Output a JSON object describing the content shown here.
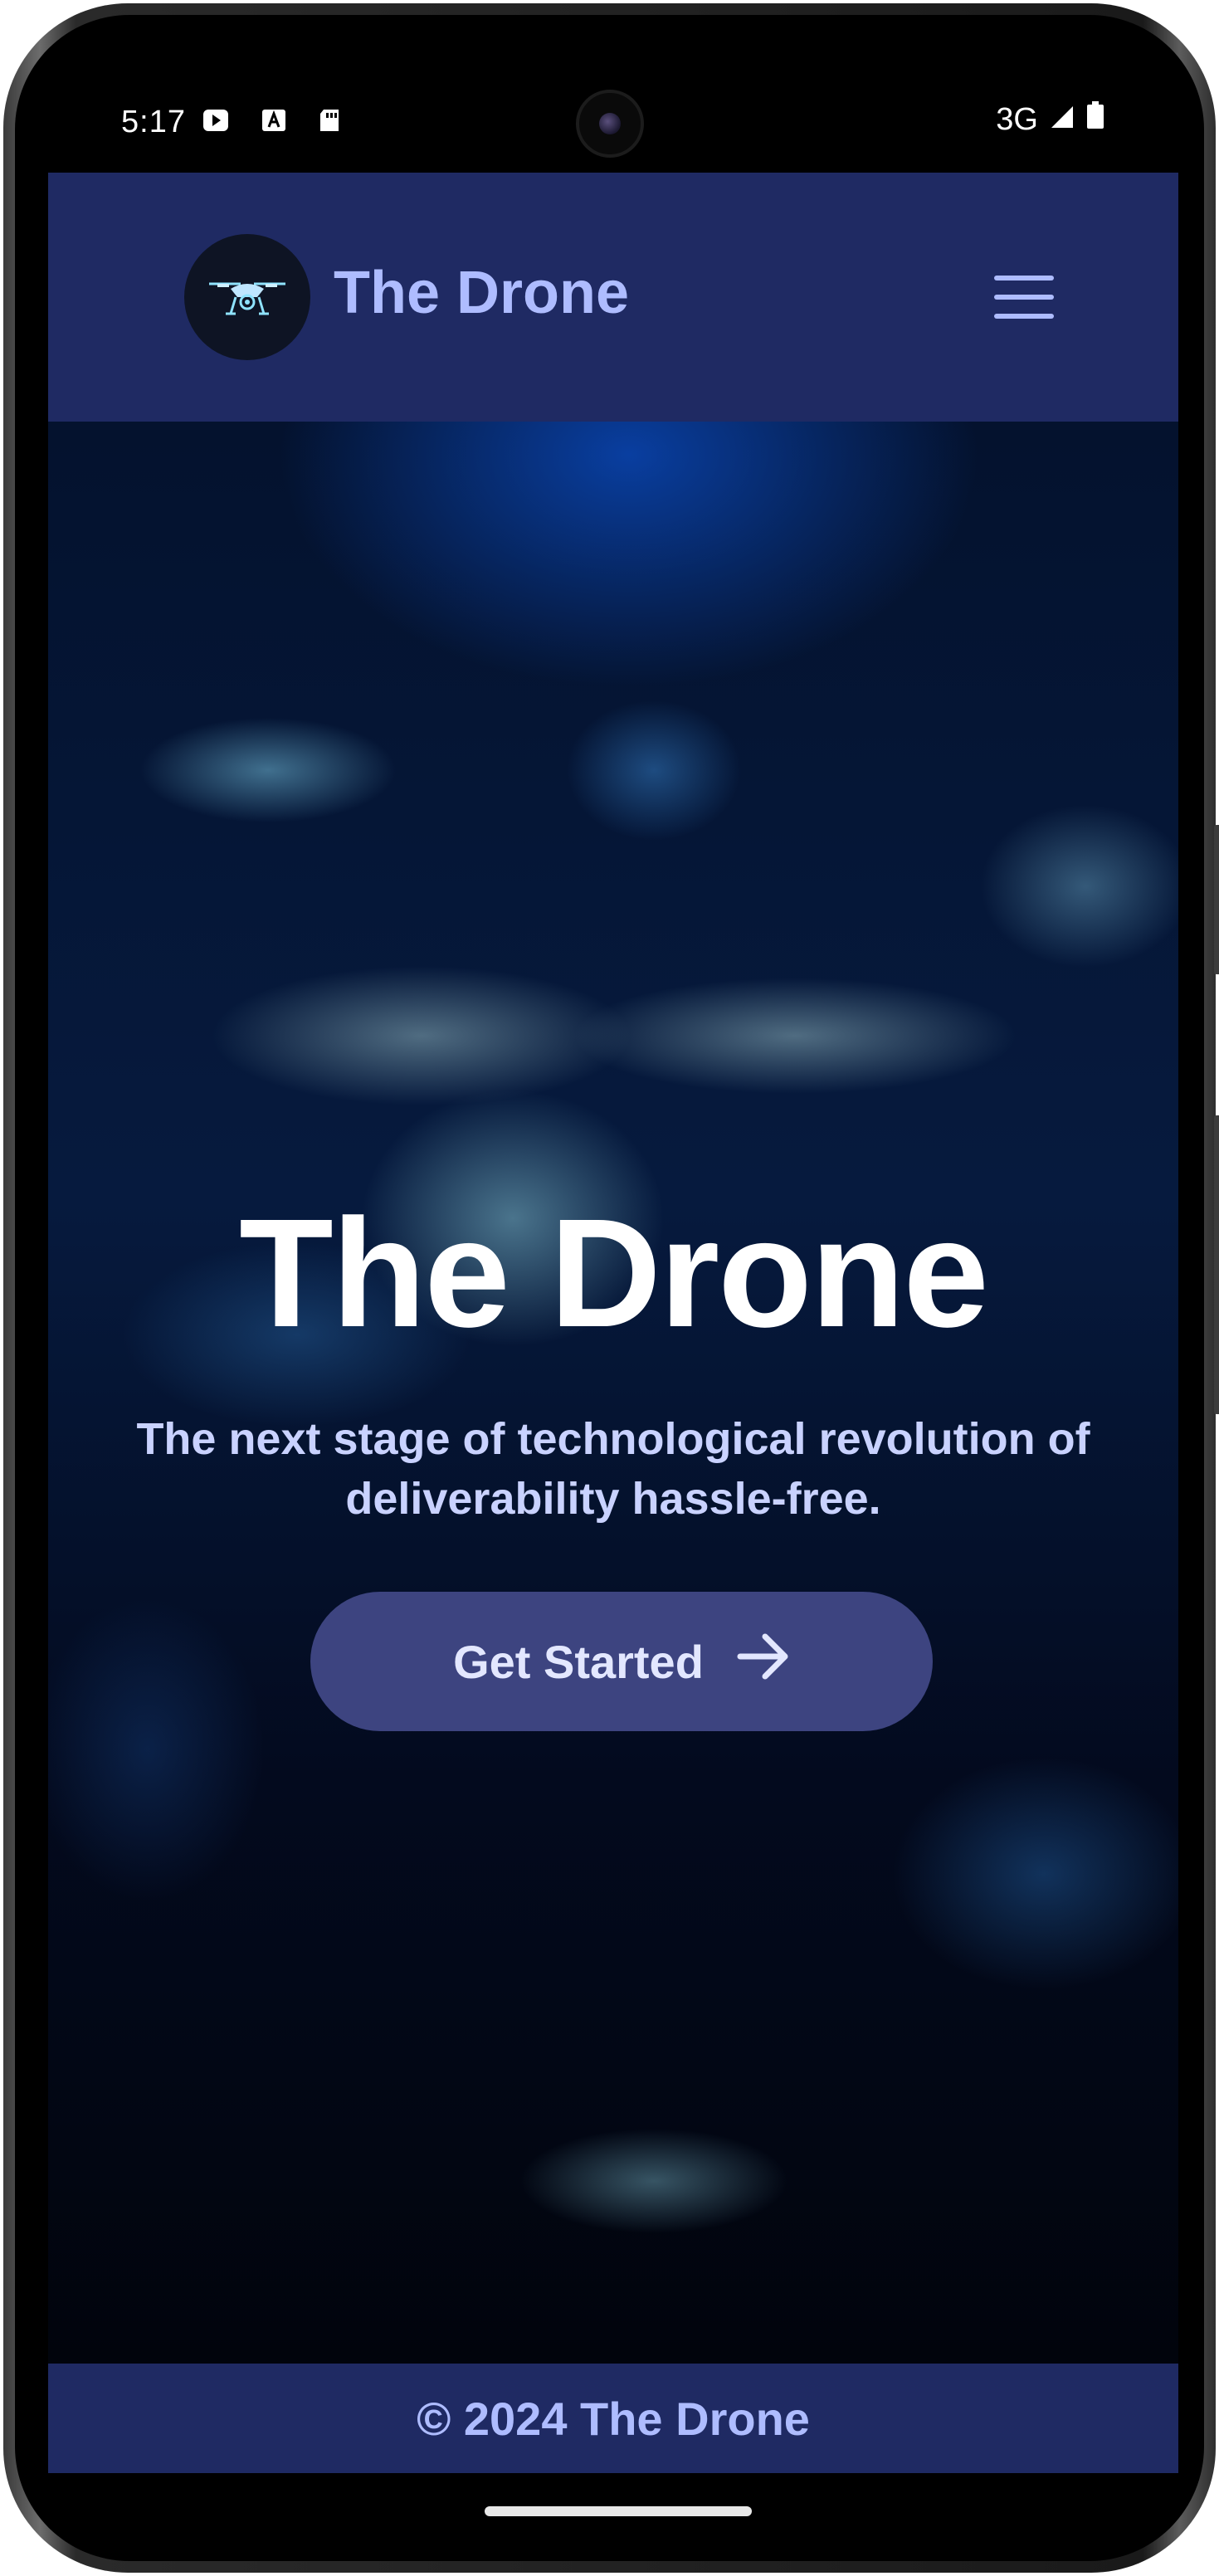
{
  "status_bar": {
    "time": "5:17",
    "network": "3G",
    "icons": [
      "play-store-notification-icon",
      "a-notification-icon",
      "sd-card-icon",
      "signal-icon",
      "battery-icon"
    ]
  },
  "navbar": {
    "brand": "The Drone",
    "logo_icon": "drone-logo-icon",
    "menu_icon": "hamburger-menu-icon"
  },
  "hero": {
    "title": "The Drone",
    "subtitle": "The next stage of technological revolution of deliverability hassle-free.",
    "cta_label": "Get Started",
    "cta_icon": "arrow-right-icon"
  },
  "footer": {
    "text": "© 2024 The Drone"
  },
  "colors": {
    "navbar_bg": "#1f2a63",
    "brand_text": "#aebcff",
    "cta_bg": "#3d4480",
    "hero_title": "#ffffff",
    "hero_subtitle": "#c9d2ff"
  }
}
